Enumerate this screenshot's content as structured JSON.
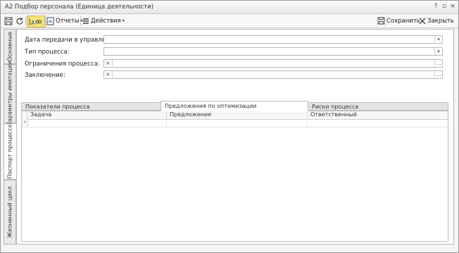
{
  "window": {
    "title": "А2 Подбор персонала (Единица деятельности)",
    "controls": [
      "?",
      "▫",
      "×"
    ]
  },
  "toolbar": {
    "reports_label": "Отчеты",
    "actions_label": "Действия",
    "save_label": "Сохранить",
    "close_label": "Закрыть"
  },
  "side_tabs": [
    {
      "label": "Основные",
      "selected": false
    },
    {
      "label": "Параметры имитации",
      "selected": false
    },
    {
      "label": "Паспорт процесса",
      "selected": true
    },
    {
      "label": "Жизненный цикл",
      "selected": false
    }
  ],
  "form": {
    "fields": [
      {
        "label": "Дата передачи в управление :",
        "value": "",
        "button": "▾"
      },
      {
        "label": "Тип процесса:",
        "value": "",
        "button": "▾"
      },
      {
        "label": "Ограничения процесса:",
        "value": "",
        "button": "…",
        "clear": "×"
      },
      {
        "label": "Заключение:",
        "value": "",
        "button": "…",
        "clear": "×"
      }
    ]
  },
  "process_tabs": [
    {
      "label": "Показатели процесса",
      "selected": false
    },
    {
      "label": "Предложения по оптимизации",
      "selected": true
    },
    {
      "label": "Риски процесса",
      "selected": false
    }
  ],
  "grid": {
    "columns": [
      "Задача",
      "Предложения",
      "Ответственный"
    ],
    "new_row_marker": "*"
  },
  "colors": {
    "active_tool": "#f6e27a",
    "border": "#b8b8b8"
  }
}
